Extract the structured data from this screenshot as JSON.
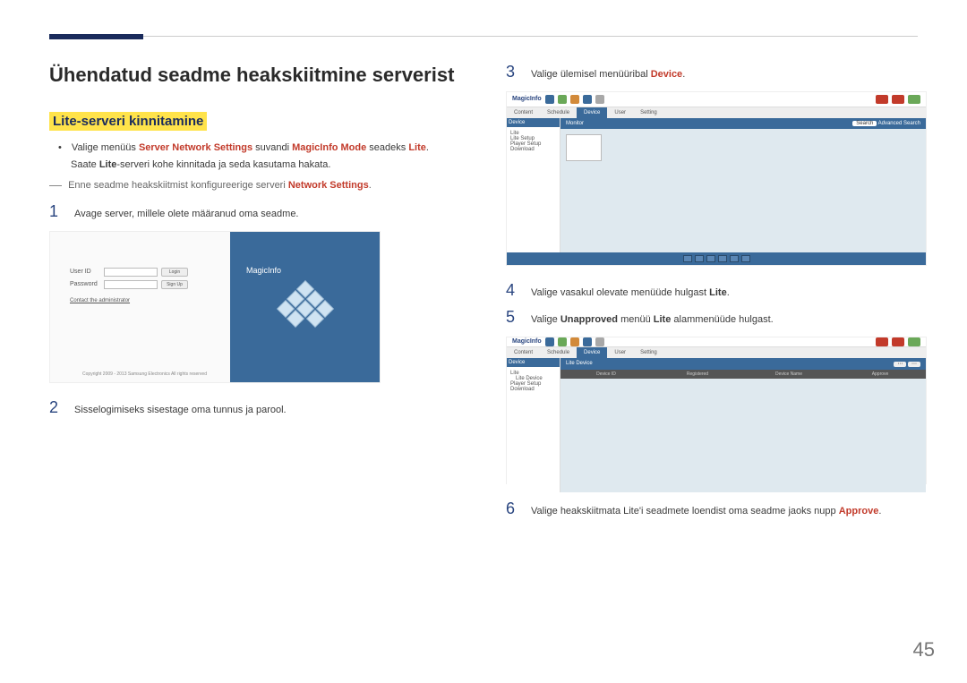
{
  "page_number": "45",
  "title": "Ühendatud seadme heakskiitmine serverist",
  "section_title": "Lite-serveri kinnitamine",
  "bullet_parts": {
    "b1a": "Valige menüüs ",
    "b1b": "Server Network Settings",
    "b1c": " suvandi ",
    "b1d": "MagicInfo Mode",
    "b1e": " seadeks ",
    "b1f": "Lite",
    "b1g": ".",
    "b2a": "Saate ",
    "b2b": "Lite",
    "b2c": "-serveri kohe kinnitada ja seda kasutama hakata."
  },
  "note": {
    "a": "Enne seadme heakskiitmist konfigureerige serveri ",
    "b": "Network Settings",
    "c": "."
  },
  "steps": {
    "s1": {
      "n": "1",
      "t": "Avage server, millele olete määranud oma seadme."
    },
    "s2": {
      "n": "2",
      "t": "Sisselogimiseks sisestage oma tunnus ja parool."
    },
    "s3": {
      "n": "3",
      "a": "Valige ülemisel menüüribal ",
      "b": "Device",
      "c": "."
    },
    "s4": {
      "n": "4",
      "a": "Valige vasakul olevate menüüde hulgast ",
      "b": "Lite",
      "c": "."
    },
    "s5": {
      "n": "5",
      "a": "Valige ",
      "b": "Unapproved",
      "c": " menüü ",
      "d": "Lite",
      "e": " alammenüüde hulgast."
    },
    "s6": {
      "n": "6",
      "a": "Valige heakskiitmata Lite'i seadmete loendist oma seadme jaoks nupp ",
      "b": "Approve",
      "c": "."
    }
  },
  "login_shot": {
    "user_id": "User ID",
    "password": "Password",
    "login": "Login",
    "signup": "Sign Up",
    "admin": "Contact the administrator",
    "copy": "Copyright 2009 - 2013 Samsung Electronics All rights reserved",
    "logo": "MagicInfo"
  },
  "app_shot": {
    "logo": "MagicInfo",
    "tabs": {
      "content": "Content",
      "schedule": "Schedule",
      "device": "Device",
      "user": "User",
      "setting": "Setting"
    },
    "side_header": "Device",
    "side_items": [
      "Lite",
      "Lite Setup",
      "Player Setup",
      "Download"
    ],
    "monitor_label": "Monitor",
    "search_btn": "Search",
    "advanced": "Advanced Search",
    "lite_sub": "Lite Device",
    "grid_cols": [
      "Device ID",
      "",
      "Registered",
      "Device Name",
      "",
      "Approve"
    ]
  }
}
